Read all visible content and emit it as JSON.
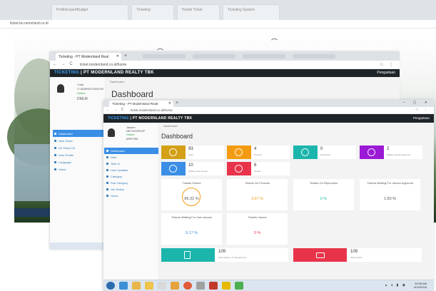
{
  "back_window": {
    "tabs": [
      "ProfileExpertBudget",
      "Ticketing",
      "Hostel Ticket",
      "Ticketing System"
    ],
    "url": "ticket.bo.oemcland.co.id"
  },
  "middle_window": {
    "tab_title": "Ticketing - PT Modernland Real",
    "url": "ticket.modernland.co.id/home",
    "brand_prefix": "TICKETING",
    "brand_suffix": "| PT MODERNLAND REALTY TBK",
    "user_menu": "Pengaduan",
    "breadcrumb": "Dashboard",
    "page_title": "Dashboard",
    "profile": {
      "name": "Yuda",
      "role": "IT ADMINISTRATOR",
      "status": "Online",
      "company": "DMLM"
    },
    "menu": [
      {
        "label": "Dashboard",
        "active": true
      },
      {
        "label": "New Ticket",
        "active": false
      },
      {
        "label": "On Ticket On",
        "active": false
      },
      {
        "label": "User Profile",
        "active": false
      },
      {
        "label": "Language",
        "active": false
      },
      {
        "label": "Home",
        "active": false
      }
    ]
  },
  "front_window": {
    "tab_title": "Ticketing - PT Modernland Realt",
    "url": "ticket.modernland.co.id/home",
    "brand_prefix": "TICKETING",
    "brand_suffix": "| PT MODERNLAND REALTY TBK",
    "user_menu": "Pengaduan",
    "breadcrumb": "Dashboard",
    "page_title": "Dashboard",
    "profile": {
      "name": "Jaksen",
      "role": "NETWORKOP",
      "status": "Online",
      "company": "MRRTBK"
    },
    "menu": [
      {
        "label": "Dashboard",
        "active": true
      },
      {
        "label": "Wait",
        "active": false
      },
      {
        "label": "Tiket In",
        "active": false
      },
      {
        "label": "User Updates",
        "active": false
      },
      {
        "label": "Category",
        "active": false
      },
      {
        "label": "Sub Category",
        "active": false
      },
      {
        "label": "Job Status",
        "active": false
      },
      {
        "label": "Home",
        "active": false
      }
    ],
    "stats_row1": [
      {
        "value": "93",
        "label": "Open",
        "color": "#d4a017"
      },
      {
        "value": "4",
        "label": "Process",
        "color": "#f39c12"
      },
      {
        "value": "0",
        "label": "Reopened",
        "color": "#1bb5ac"
      },
      {
        "value": "2",
        "label": "Waiting Vendor Approval",
        "color": "#9b1ad6"
      }
    ],
    "stats_row2": [
      {
        "value": "10",
        "label": "Waiting User Accept",
        "color": "#3a8ee6"
      },
      {
        "value": "6",
        "label": "Closed",
        "color": "#e8344b"
      }
    ],
    "cards_row1": [
      {
        "title": "Tickets Solved",
        "value": "86.32 %",
        "color": "#555555",
        "ring": true
      },
      {
        "title": "Tickets On Process",
        "value": "3.67 %",
        "color": "#f39c12",
        "ring": false
      },
      {
        "title": "Tickets On Reprocess",
        "value": "0 %",
        "color": "#1bb5ac",
        "ring": false
      },
      {
        "title": "Tickets Waiting For Vendor Approval",
        "value": "1.83 %",
        "color": "#555555",
        "ring": false
      }
    ],
    "cards_row2": [
      {
        "title": "Tickets Waiting For User Accept",
        "value": "9.17 %",
        "color": "#3a8ee6"
      },
      {
        "title": "Tickets Cancel",
        "value": "0 %",
        "color": "#e8344b"
      }
    ],
    "bottom_stats": [
      {
        "value": "109",
        "label": "Total Ticket in IT Departments",
        "color": "#1bb5ac"
      },
      {
        "value": "109",
        "label": "Total Tickets",
        "color": "#e8344b"
      }
    ],
    "clock": {
      "time": "09:58 AM",
      "date": "8/24/2018"
    }
  }
}
